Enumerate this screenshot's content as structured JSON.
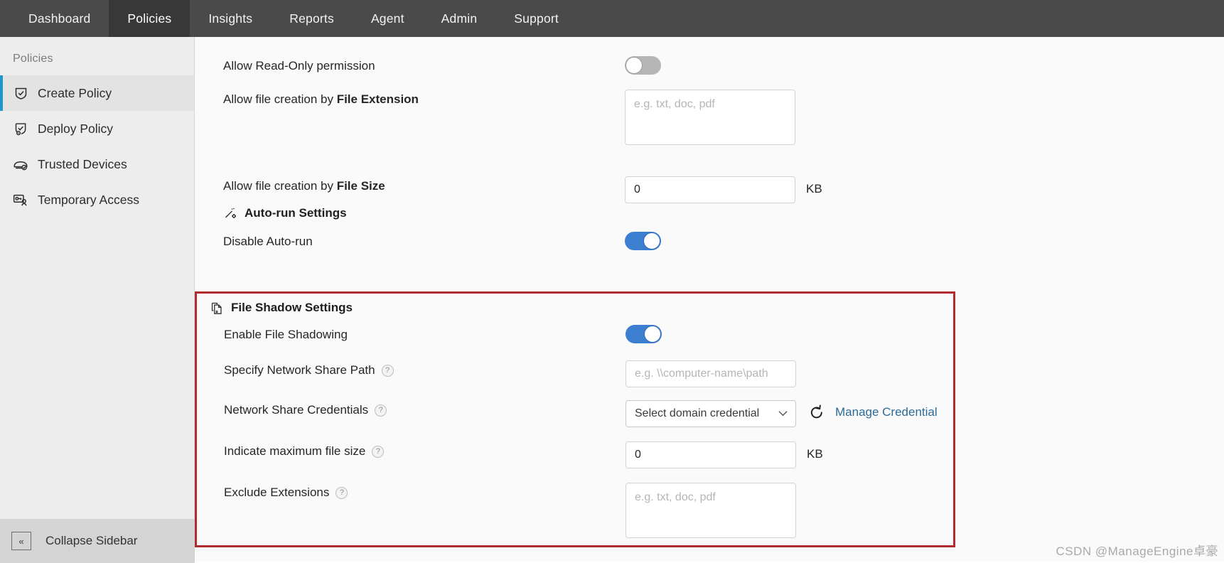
{
  "topnav": {
    "items": [
      {
        "label": "Dashboard",
        "active": false
      },
      {
        "label": "Policies",
        "active": true
      },
      {
        "label": "Insights",
        "active": false
      },
      {
        "label": "Reports",
        "active": false
      },
      {
        "label": "Agent",
        "active": false
      },
      {
        "label": "Admin",
        "active": false
      },
      {
        "label": "Support",
        "active": false
      }
    ]
  },
  "sidebar": {
    "title": "Policies",
    "items": [
      {
        "label": "Create Policy",
        "icon": "shield-check-icon",
        "active": true
      },
      {
        "label": "Deploy Policy",
        "icon": "deploy-policy-icon",
        "active": false
      },
      {
        "label": "Trusted Devices",
        "icon": "trusted-device-icon",
        "active": false
      },
      {
        "label": "Temporary Access",
        "icon": "temporary-access-icon",
        "active": false
      }
    ],
    "collapse_label": "Collapse Sidebar",
    "collapse_icon": "chevron-double-left-icon"
  },
  "main": {
    "read_only": {
      "label": "Allow Read-Only permission",
      "toggle_state": "off"
    },
    "file_extension": {
      "label_prefix": "Allow file creation by ",
      "label_bold": "File Extension",
      "placeholder": "e.g. txt, doc, pdf",
      "value": ""
    },
    "file_size": {
      "label_prefix": "Allow file creation by ",
      "label_bold": "File Size",
      "value": "0",
      "unit": "KB"
    },
    "autorun_section": {
      "title": "Auto-run Settings",
      "icon": "magic-wand-settings-icon"
    },
    "disable_autorun": {
      "label": "Disable Auto-run",
      "toggle_state": "on"
    },
    "shadow_section": {
      "title": "File Shadow Settings",
      "icon": "file-copy-icon",
      "highlight_color": "#b02b30"
    },
    "enable_shadowing": {
      "label": "Enable File Shadowing",
      "toggle_state": "on"
    },
    "network_share_path": {
      "label": "Specify Network Share Path",
      "help": "?",
      "placeholder": "e.g. \\\\computer-name\\path",
      "value": ""
    },
    "network_credentials": {
      "label": "Network Share Credentials",
      "help": "?",
      "selected": "Select domain credential",
      "chevron": "⌄",
      "refresh_icon": "refresh-icon",
      "manage_link": "Manage Credential"
    },
    "max_file_size": {
      "label": "Indicate maximum file size",
      "help": "?",
      "value": "0",
      "unit": "KB"
    },
    "exclude_extensions": {
      "label": "Exclude Extensions",
      "help": "?",
      "placeholder": "e.g. txt, doc, pdf",
      "value": ""
    }
  },
  "watermark": {
    "text": "CSDN @ManageEngine卓豪"
  },
  "colors": {
    "accent_blue": "#3c7fd1",
    "link_blue": "#2c6b96",
    "highlight_red": "#b02b30",
    "nav_bg": "#4a4a4a"
  }
}
